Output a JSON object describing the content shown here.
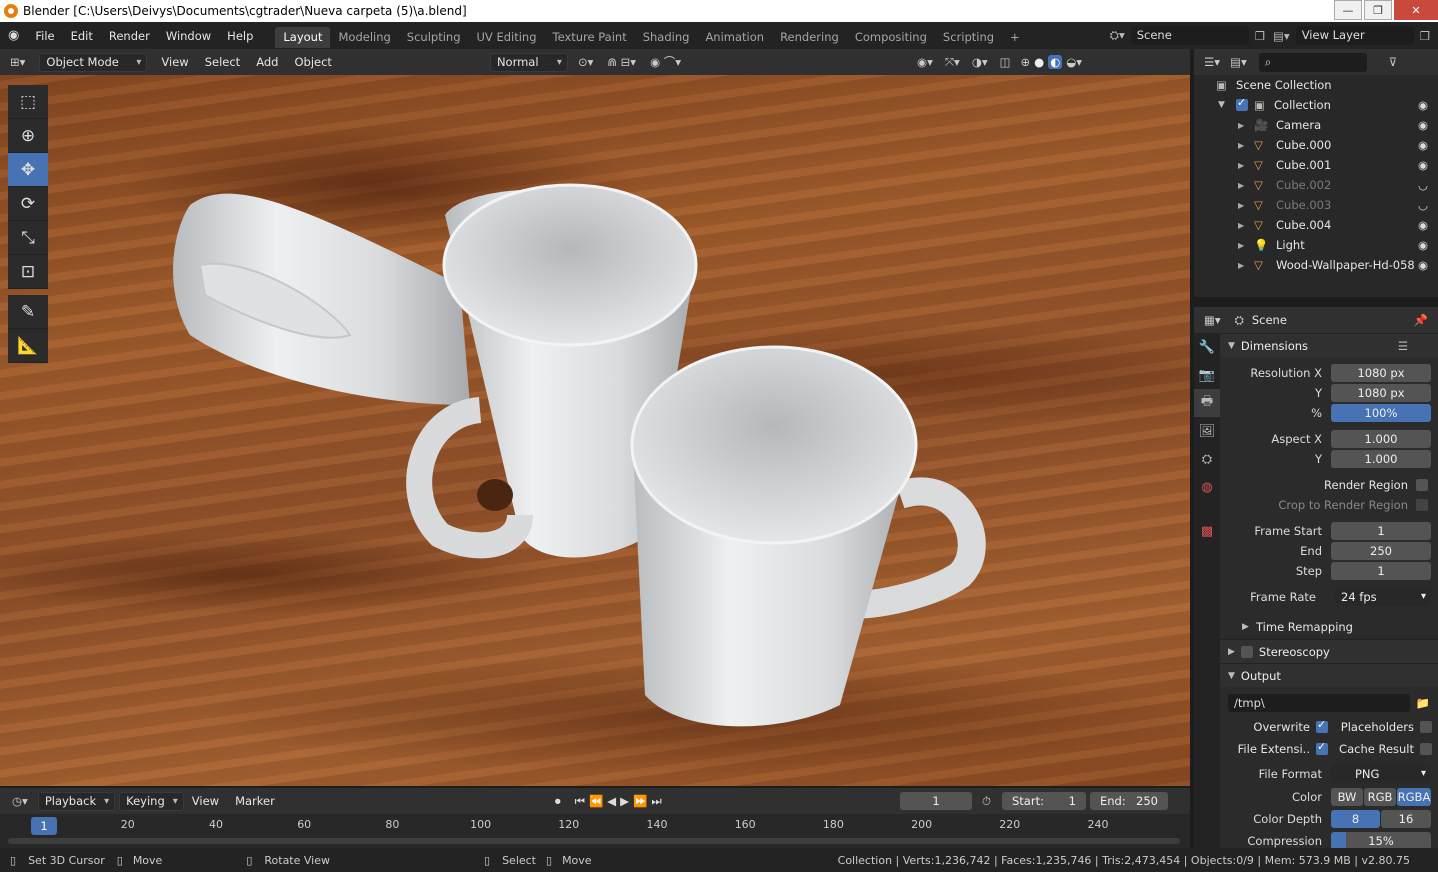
{
  "window": {
    "title": "Blender [C:\\Users\\Deivys\\Documents\\cgtrader\\Nueva carpeta (5)\\a.blend]",
    "min": "—",
    "max": "❐",
    "close": "✕"
  },
  "menu": [
    "File",
    "Edit",
    "Render",
    "Window",
    "Help"
  ],
  "workspaces": [
    "Layout",
    "Modeling",
    "Sculpting",
    "UV Editing",
    "Texture Paint",
    "Shading",
    "Animation",
    "Rendering",
    "Compositing",
    "Scripting",
    "+"
  ],
  "active_workspace": "Layout",
  "scene_name": "Scene",
  "view_layer": "View Layer",
  "viewport_header": {
    "mode": "Object Mode",
    "menus": [
      "View",
      "Select",
      "Add",
      "Object"
    ],
    "orientation": "Normal"
  },
  "tools": [
    "select-box-icon",
    "cursor-icon",
    "move-icon",
    "rotate-icon",
    "scale-icon",
    "transform-icon",
    "annotate-icon",
    "measure-icon"
  ],
  "outliner": {
    "root": "Scene Collection",
    "collection": "Collection",
    "items": [
      {
        "name": "Camera",
        "type": "camera",
        "visible": true,
        "dim": false
      },
      {
        "name": "Cube.000",
        "type": "mesh",
        "visible": true,
        "dim": false
      },
      {
        "name": "Cube.001",
        "type": "mesh",
        "visible": true,
        "dim": false
      },
      {
        "name": "Cube.002",
        "type": "mesh",
        "visible": false,
        "dim": true
      },
      {
        "name": "Cube.003",
        "type": "mesh",
        "visible": false,
        "dim": true
      },
      {
        "name": "Cube.004",
        "type": "mesh",
        "visible": true,
        "dim": false
      },
      {
        "name": "Light",
        "type": "light",
        "visible": true,
        "dim": false
      },
      {
        "name": "Wood-Wallpaper-Hd-058",
        "type": "mesh",
        "visible": true,
        "dim": false
      }
    ]
  },
  "properties": {
    "context": "Scene",
    "dimensions_title": "Dimensions",
    "resolution_x_label": "Resolution X",
    "resolution_x": "1080 px",
    "resolution_y_label": "Y",
    "resolution_y": "1080 px",
    "percent_label": "%",
    "percent": "100%",
    "aspect_x_label": "Aspect X",
    "aspect_x": "1.000",
    "aspect_y_label": "Y",
    "aspect_y": "1.000",
    "render_region": "Render Region",
    "crop_region": "Crop to Render Region",
    "frame_start_label": "Frame Start",
    "frame_start": "1",
    "end_label": "End",
    "end": "250",
    "step_label": "Step",
    "step": "1",
    "frame_rate_label": "Frame Rate",
    "frame_rate": "24 fps",
    "time_remapping": "Time Remapping",
    "stereoscopy": "Stereoscopy",
    "output_title": "Output",
    "output_path": "/tmp\\",
    "overwrite": "Overwrite",
    "placeholders": "Placeholders",
    "file_ext": "File Extensi..",
    "cache": "Cache Result",
    "file_format_label": "File Format",
    "file_format": "PNG",
    "color_label": "Color",
    "color_opts": [
      "BW",
      "RGB",
      "RGBA"
    ],
    "depth_label": "Color Depth",
    "depth_opts": [
      "8",
      "16"
    ],
    "compression_label": "Compression",
    "compression": "15%"
  },
  "timeline": {
    "menus": [
      "Playback",
      "Keying",
      "View",
      "Marker"
    ],
    "current_frame": "1",
    "start_label": "Start:",
    "start": "1",
    "end_label": "End:",
    "end": "250",
    "ticks": [
      "20",
      "40",
      "60",
      "80",
      "100",
      "120",
      "140",
      "160",
      "180",
      "200",
      "220",
      "240"
    ],
    "cursor": "1"
  },
  "statusbar": {
    "hints": [
      "Set 3D Cursor",
      "Move",
      "Rotate View",
      "Select",
      "Move"
    ],
    "stats": "Collection | Verts:1,236,742 | Faces:1,235,746 | Tris:2,473,454 | Objects:0/9 | Mem: 573.9 MB | v2.80.75"
  },
  "colors": {
    "accent": "#4772b3",
    "orange": "#e87d0d",
    "mesh": "#e89a4a"
  }
}
